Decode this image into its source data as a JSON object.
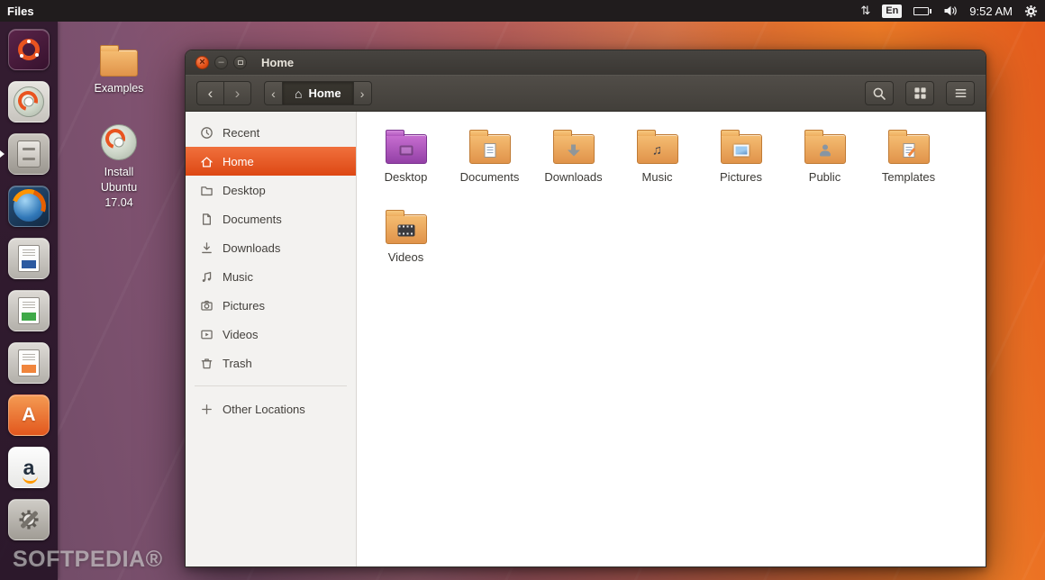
{
  "topbar": {
    "app_name": "Files",
    "keyboard_layout": "En",
    "time": "9:52 AM"
  },
  "icons": {
    "network_arrows": "⇅",
    "close_glyph": "×",
    "minimize_glyph": "–",
    "chevron_left": "‹",
    "chevron_right": "›",
    "home_glyph": "⌂",
    "music_note": "♫",
    "software_letter": "A",
    "amazon_letter": "a"
  },
  "launcher": {
    "items": [
      {
        "icon": "ubuntu-logo-icon"
      },
      {
        "icon": "install-ubuntu-icon"
      },
      {
        "icon": "files-icon"
      },
      {
        "icon": "firefox-icon"
      },
      {
        "icon": "libreoffice-writer-icon"
      },
      {
        "icon": "libreoffice-calc-icon"
      },
      {
        "icon": "libreoffice-impress-icon"
      },
      {
        "icon": "ubuntu-software-icon"
      },
      {
        "icon": "amazon-icon"
      },
      {
        "icon": "system-settings-icon"
      }
    ]
  },
  "desktop": {
    "icons": [
      {
        "label": "Examples"
      },
      {
        "label": "Install Ubuntu 17.04"
      }
    ]
  },
  "window": {
    "title": "Home",
    "breadcrumb": "Home",
    "sidebar": [
      {
        "label": "Recent"
      },
      {
        "label": "Home"
      },
      {
        "label": "Desktop"
      },
      {
        "label": "Documents"
      },
      {
        "label": "Downloads"
      },
      {
        "label": "Music"
      },
      {
        "label": "Pictures"
      },
      {
        "label": "Videos"
      },
      {
        "label": "Trash"
      },
      {
        "label": "Other Locations"
      }
    ],
    "files": [
      {
        "label": "Desktop"
      },
      {
        "label": "Documents"
      },
      {
        "label": "Downloads"
      },
      {
        "label": "Music"
      },
      {
        "label": "Pictures"
      },
      {
        "label": "Public"
      },
      {
        "label": "Templates"
      },
      {
        "label": "Videos"
      }
    ]
  },
  "watermark": "SOFTPEDIA®",
  "colors": {
    "ubuntu_orange": "#E95420",
    "selection_orange": "#DD4814",
    "titlebar": "#3C3B37"
  }
}
